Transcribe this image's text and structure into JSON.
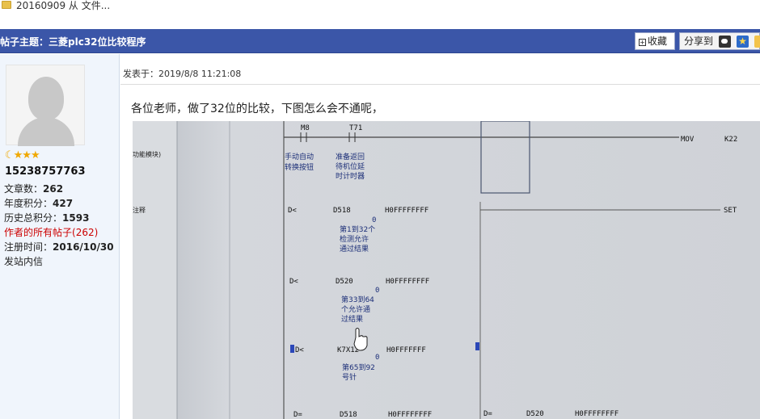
{
  "breadcrumb": {
    "text": "20160909 从 文件..."
  },
  "topic": {
    "title": "帖子主题：三菱plc32位比较程序"
  },
  "actions": {
    "favorite": "收藏",
    "share": "分享到"
  },
  "user": {
    "name": "15238757763",
    "stats": [
      {
        "label": "文章数：",
        "value": "262"
      },
      {
        "label": "年度积分：",
        "value": "427"
      },
      {
        "label": "历史总积分：",
        "value": "1593"
      },
      {
        "label": "作者的所有帖子",
        "value": "(262)"
      },
      {
        "label": "注册时间：",
        "value": "2016/10/30"
      },
      {
        "label": "发站内信",
        "value": ""
      }
    ]
  },
  "post": {
    "posted_label": "发表于：2019/8/8 11:21:08",
    "body": "各位老师，做了32位的比较，下图怎么会不通呢，"
  },
  "ladder": {
    "contacts_top": [
      "M8",
      "T71"
    ],
    "instr_mov": "MOV",
    "mov_arg": "K22",
    "note1": [
      "手动自动",
      "转换按钮"
    ],
    "note2": [
      "准备返回",
      "待机位延",
      "时计时器"
    ],
    "rows": [
      {
        "op": "D<",
        "a": "D518",
        "b": "H0FFFFFFFF",
        "zero": "0",
        "note": [
          "第1到32个",
          "检测允许",
          "通过结果"
        ]
      },
      {
        "op": "D<",
        "a": "D520",
        "b": "H0FFFFFFFF",
        "zero": "0",
        "note": [
          "第33到64",
          "个允许通",
          "过结果"
        ]
      },
      {
        "op": "D<",
        "a": "K7X12",
        "b": "H0FFFFFFF",
        "zero": "0",
        "note": [
          "第65到92",
          "号针"
        ]
      }
    ],
    "set_label": "SET",
    "bottom": {
      "op1": "D=",
      "a": "D518",
      "b": "H0FFFFFFFF",
      "op2": "D=",
      "c": "D520",
      "d": "H0FFFFFFFF"
    },
    "side_text1": "功能模块)",
    "side_text2": "注释"
  }
}
